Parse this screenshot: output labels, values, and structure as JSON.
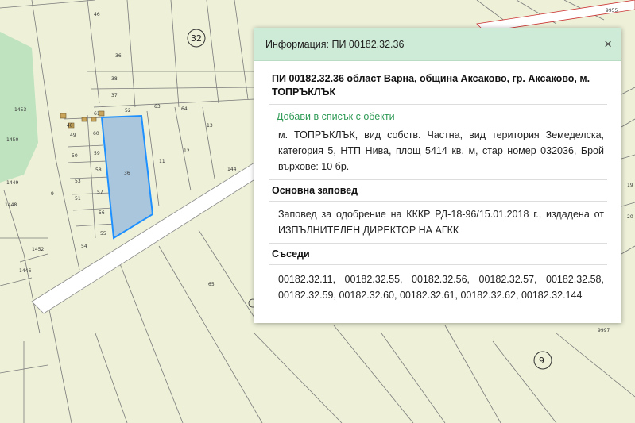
{
  "popup": {
    "title": "Информация: ПИ 00182.32.36",
    "close_glyph": "×",
    "parcel_heading": "ПИ 00182.32.36 област Варна, община Аксаково, гр. Аксаково, м. ТОПРЪКЛЪК",
    "add_link": "Добави в списък с обекти",
    "description": "м. ТОПРЪКЛЪК, вид собств. Частна, вид територия Земеделска, категория 5, НТП Нива, площ 5414 кв. м, стар номер 032036, Брой върхове: 10 бр.",
    "order_section": {
      "title": "Основна заповед",
      "text": "Заповед за одобрение на КККР РД-18-96/15.01.2018 г., издадена от ИЗПЪЛНИТЕЛЕН ДИРЕКТОР НА АГКК"
    },
    "neighbours_section": {
      "title": "Съседи",
      "items": [
        "00182.32.11,",
        "00182.32.55,",
        "00182.32.56,",
        "00182.32.57,",
        "00182.32.58,",
        "00182.32.59,",
        "00182.32.60,",
        "00182.32.61,",
        "00182.32.62,",
        "00182.32.144"
      ]
    }
  },
  "map": {
    "circle_labels": [
      "32",
      "9"
    ],
    "parcel_labels": [
      "46",
      "36",
      "38",
      "37",
      "52",
      "63",
      "64",
      "61",
      "60",
      "59",
      "58",
      "57",
      "56",
      "55",
      "54",
      "53",
      "51",
      "50",
      "49",
      "48",
      "11",
      "12",
      "13",
      "144",
      "1450",
      "1449",
      "1448",
      "1452",
      "1446",
      "1453",
      "65",
      "9997",
      "9955",
      "9",
      "19",
      "20"
    ],
    "selected_label": "36",
    "colors": {
      "background": "#eef1d8",
      "selected_fill": "#a9c6dc",
      "selected_stroke": "#1e90ff",
      "green_area": "#bfe3bf",
      "road": "#ffffff",
      "lines": "#7a7a7a"
    }
  }
}
